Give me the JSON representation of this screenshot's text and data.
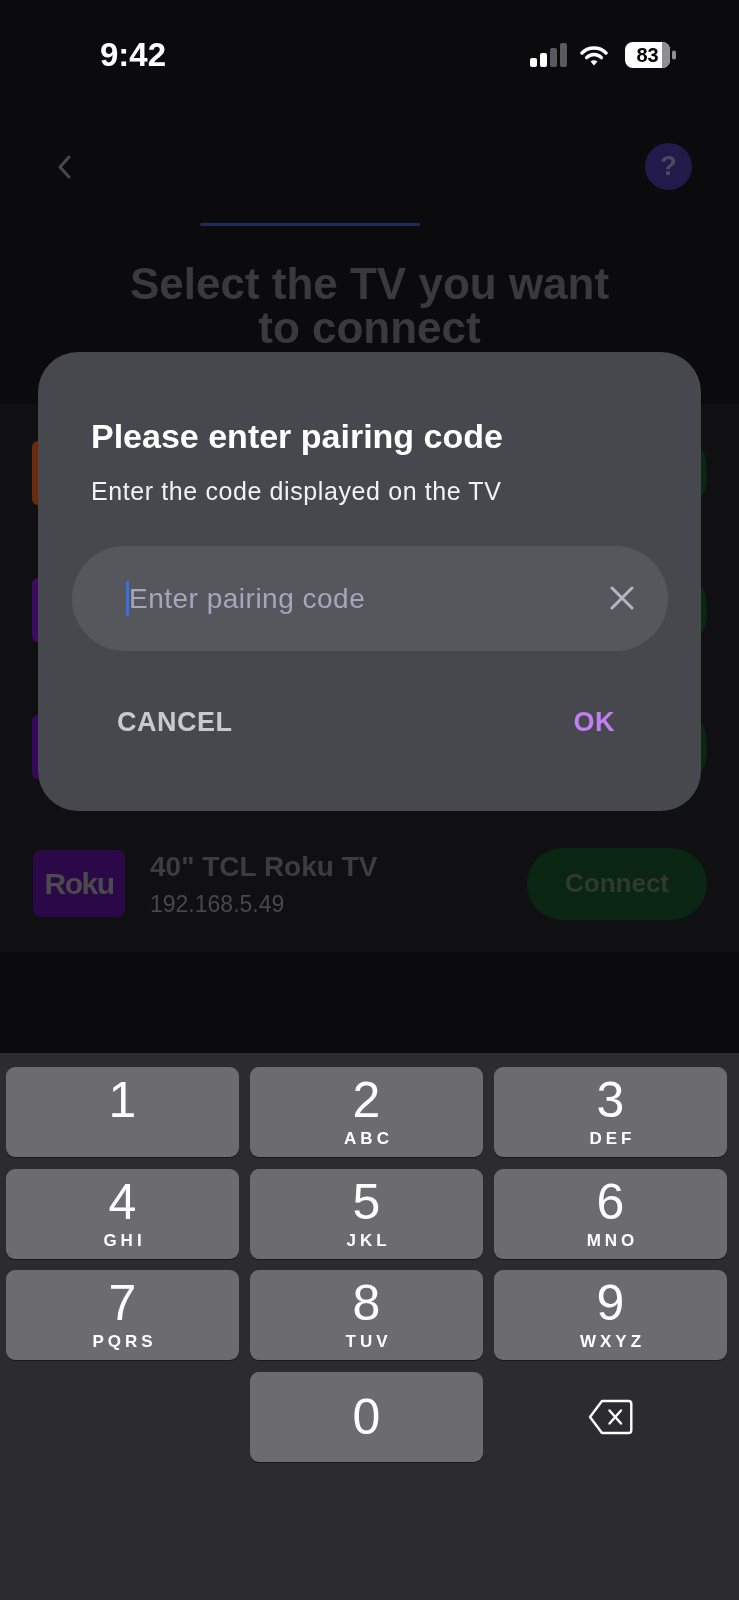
{
  "status_bar": {
    "time": "9:42",
    "battery": "83"
  },
  "header": {
    "help": "?"
  },
  "title": "Select the TV you want to connect",
  "devices": [
    {
      "kind": "covered",
      "color": "#6a2a0e"
    },
    {
      "kind": "covered",
      "color": "#3d0a60"
    },
    {
      "kind": "covered",
      "color": "#36085a"
    },
    {
      "kind": "device",
      "color": "#2b0948",
      "logo": "Roku",
      "name": "40\" TCL Roku TV",
      "address": "192.168.5.49",
      "button": "Connect"
    }
  ],
  "dialog": {
    "title": "Please enter pairing code",
    "message": "Enter the code displayed on the TV",
    "field": {
      "placeholder": "Enter pairing code"
    },
    "buttons": [
      {
        "kind": "cancel",
        "label": "CANCEL"
      },
      {
        "kind": "confirm",
        "label": "OK"
      }
    ]
  },
  "keypad": {
    "keys": [
      {
        "kind": "digit",
        "digit": "1"
      },
      {
        "kind": "digit",
        "digit": "2",
        "letters": "ABC"
      },
      {
        "kind": "digit",
        "digit": "3",
        "letters": "DEF"
      },
      {
        "kind": "digit",
        "digit": "4",
        "letters": "GHI"
      },
      {
        "kind": "digit",
        "digit": "5",
        "letters": "JKL"
      },
      {
        "kind": "digit",
        "digit": "6",
        "letters": "MNO"
      },
      {
        "kind": "digit",
        "digit": "7",
        "letters": "PQRS"
      },
      {
        "kind": "digit",
        "digit": "8",
        "letters": "TUV"
      },
      {
        "kind": "digit",
        "digit": "9",
        "letters": "WXYZ"
      },
      {
        "kind": "digit",
        "digit": "0"
      },
      {
        "kind": "backspace"
      }
    ]
  }
}
